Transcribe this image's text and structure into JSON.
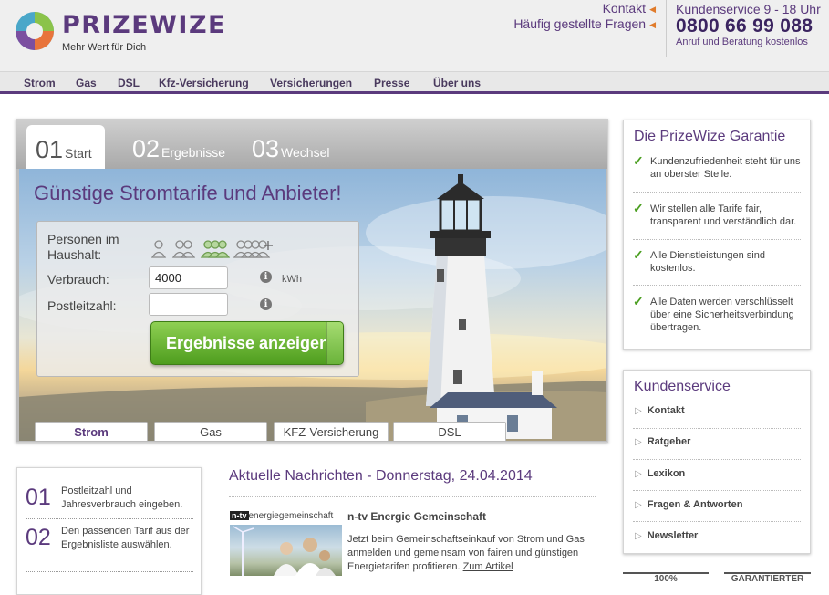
{
  "header": {
    "logo_name": "PRIZEWIZE",
    "logo_tagline": "Mehr Wert für Dich",
    "links": [
      "Kontakt",
      "Häufig gestellte Fragen"
    ],
    "service_hours": "Kundenservice 9 - 18 Uhr",
    "phone": "0800 66 99 088",
    "phone_note": "Anruf und Beratung kostenlos"
  },
  "nav": [
    "Strom",
    "Gas",
    "DSL",
    "Kfz-Versicherung",
    "Versicherungen",
    "Presse",
    "Über uns"
  ],
  "steps": [
    {
      "num": "01",
      "label": "Start"
    },
    {
      "num": "02",
      "label": "Ergebnisse"
    },
    {
      "num": "03",
      "label": "Wechsel"
    }
  ],
  "hero": {
    "title": "Günstige Stromtarife und Anbieter!",
    "persons_label": "Personen im Haushalt:",
    "consumption_label": "Verbrauch:",
    "consumption_value": "4000",
    "consumption_unit": "kWh",
    "zip_label": "Postleitzahl:",
    "zip_value": "",
    "info_icon": "i",
    "submit_label": "Ergebnisse anzeigen"
  },
  "categories": [
    "Strom",
    "Gas",
    "KFZ-Versicherung",
    "DSL"
  ],
  "guarantee": {
    "title": "Die PrizeWize Garantie",
    "items": [
      "Kundenzufriedenheit steht für uns an oberster Stelle.",
      "Wir stellen alle Tarife fair, transparent und verständlich dar.",
      "Alle Dienstleistungen sind kostenlos.",
      "Alle Daten werden verschlüsselt über eine Sicherheitsverbindung übertragen."
    ]
  },
  "service": {
    "title": "Kundenservice",
    "links": [
      "Kontakt",
      "Ratgeber",
      "Lexikon",
      "Fragen & Antworten",
      "Newsletter"
    ]
  },
  "howto": [
    {
      "num": "01",
      "text": "Postleitzahl und Jahresverbrauch eingeben."
    },
    {
      "num": "02",
      "text": "Den passenden Tarif aus der Ergebnisliste auswählen."
    }
  ],
  "news": {
    "title": "Aktuelle Nachrichten - Donnerstag, 24.04.2014",
    "source_logo_a": "n-tv",
    "source_logo_b": "energiegemeinschaft",
    "headline": "n-tv Energie Gemeinschaft",
    "text": "Jetzt beim Gemeinschaftseinkauf von Strom und Gas anmelden und gemeinsam von fairen und günstigen Energietarifen profitieren.",
    "link": "Zum Artikel"
  },
  "badges": [
    "100%",
    "GARANTIERTER"
  ],
  "colors": {
    "brand": "#5b3a7d",
    "accent": "#e07b2b",
    "button": "#5fb02a"
  }
}
